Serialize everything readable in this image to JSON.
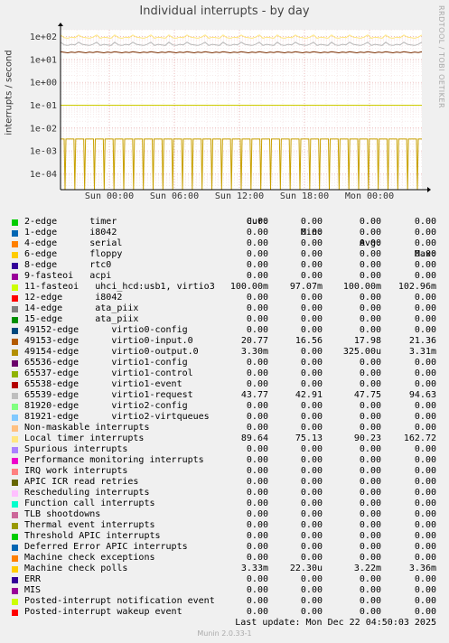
{
  "title": "Individual interrupts - by day",
  "ylabel": "interrupts / second",
  "watermark": "RRDTOOL / TOBI OETIKER",
  "footer": {
    "last_update": "Last update:  Mon Dec 22 04:50:03 2025",
    "version": "Munin 2.0.33-1"
  },
  "chart_data": {
    "type": "line",
    "title": "Individual interrupts - by day",
    "ylabel": "interrupts / second",
    "yscale": "log",
    "ylim": [
      2e-05,
      200
    ],
    "ytick_labels": [
      "1e+02",
      "1e+01",
      "1e+00",
      "1e-01",
      "1e-02",
      "1e-03",
      "1e-04"
    ],
    "yticks": [
      100,
      10,
      1,
      0.1,
      0.01,
      0.001,
      0.0001
    ],
    "xtick_labels": [
      "Sun 00:00",
      "Sun 06:00",
      "Sun 12:00",
      "Sun 18:00",
      "Mon 00:00"
    ],
    "grid": true,
    "series": [
      {
        "name": "Local timer interrupts",
        "color": "#FFE680",
        "level": 89.64
      },
      {
        "name": "virtio1-request",
        "color": "#B8B8B8",
        "level": 43.77
      },
      {
        "name": "virtio0-input.0",
        "color": "#7A2E00",
        "level": 20.77
      },
      {
        "name": "uhci_hcd:usb1, virtio3",
        "color": "#CCCC00",
        "level": 0.1
      },
      {
        "name": "Machine check polls",
        "color": "#C8A000",
        "level": 0.00333
      }
    ]
  },
  "legend": {
    "headers": {
      "cur": "Cur:",
      "min": "Min:",
      "avg": "Avg:",
      "max": "Max:"
    },
    "rows": [
      {
        "name": "2-edge      timer",
        "color": "#00CC00",
        "cur": "0.00",
        "min": "0.00",
        "avg": "0.00",
        "max": "0.00"
      },
      {
        "name": "1-edge      i8042",
        "color": "#0066B3",
        "cur": "0.00",
        "min": "0.00",
        "avg": "0.00",
        "max": "0.00"
      },
      {
        "name": "4-edge      serial",
        "color": "#FF8000",
        "cur": "0.00",
        "min": "0.00",
        "avg": "0.00",
        "max": "0.00"
      },
      {
        "name": "6-edge      floppy",
        "color": "#FFCC00",
        "cur": "0.00",
        "min": "0.00",
        "avg": "0.00",
        "max": "0.00"
      },
      {
        "name": "8-edge      rtc0",
        "color": "#330099",
        "cur": "0.00",
        "min": "0.00",
        "avg": "0.00",
        "max": "0.00"
      },
      {
        "name": "9-fasteoi   acpi",
        "color": "#990099",
        "cur": "0.00",
        "min": "0.00",
        "avg": "0.00",
        "max": "0.00"
      },
      {
        "name": "11-fasteoi   uhci_hcd:usb1, virtio3",
        "color": "#CCFF00",
        "cur": "100.00m",
        "min": "97.07m",
        "avg": "100.00m",
        "max": "102.96m"
      },
      {
        "name": "12-edge      i8042",
        "color": "#FF0000",
        "cur": "0.00",
        "min": "0.00",
        "avg": "0.00",
        "max": "0.00"
      },
      {
        "name": "14-edge      ata_piix",
        "color": "#808080",
        "cur": "0.00",
        "min": "0.00",
        "avg": "0.00",
        "max": "0.00"
      },
      {
        "name": "15-edge      ata_piix",
        "color": "#008F00",
        "cur": "0.00",
        "min": "0.00",
        "avg": "0.00",
        "max": "0.00"
      },
      {
        "name": "49152-edge      virtio0-config",
        "color": "#00487D",
        "cur": "0.00",
        "min": "0.00",
        "avg": "0.00",
        "max": "0.00"
      },
      {
        "name": "49153-edge      virtio0-input.0",
        "color": "#B35A00",
        "cur": "20.77",
        "min": "16.56",
        "avg": "17.98",
        "max": "21.36"
      },
      {
        "name": "49154-edge      virtio0-output.0",
        "color": "#B38F00",
        "cur": "3.30m",
        "min": "0.00",
        "avg": "325.00u",
        "max": "3.31m"
      },
      {
        "name": "65536-edge      virtio1-config",
        "color": "#6B006B",
        "cur": "0.00",
        "min": "0.00",
        "avg": "0.00",
        "max": "0.00"
      },
      {
        "name": "65537-edge      virtio1-control",
        "color": "#8FB300",
        "cur": "0.00",
        "min": "0.00",
        "avg": "0.00",
        "max": "0.00"
      },
      {
        "name": "65538-edge      virtio1-event",
        "color": "#B30000",
        "cur": "0.00",
        "min": "0.00",
        "avg": "0.00",
        "max": "0.00"
      },
      {
        "name": "65539-edge      virtio1-request",
        "color": "#BEBEBE",
        "cur": "43.77",
        "min": "42.91",
        "avg": "47.75",
        "max": "94.63"
      },
      {
        "name": "81920-edge      virtio2-config",
        "color": "#80FF80",
        "cur": "0.00",
        "min": "0.00",
        "avg": "0.00",
        "max": "0.00"
      },
      {
        "name": "81921-edge      virtio2-virtqueues",
        "color": "#80C9FF",
        "cur": "0.00",
        "min": "0.00",
        "avg": "0.00",
        "max": "0.00"
      },
      {
        "name": "Non-maskable interrupts",
        "color": "#FFC080",
        "cur": "0.00",
        "min": "0.00",
        "avg": "0.00",
        "max": "0.00"
      },
      {
        "name": "Local timer interrupts",
        "color": "#FFE680",
        "cur": "89.64",
        "min": "75.13",
        "avg": "90.23",
        "max": "162.72"
      },
      {
        "name": "Spurious interrupts",
        "color": "#AA80FF",
        "cur": "0.00",
        "min": "0.00",
        "avg": "0.00",
        "max": "0.00"
      },
      {
        "name": "Performance monitoring interrupts",
        "color": "#EE00CC",
        "cur": "0.00",
        "min": "0.00",
        "avg": "0.00",
        "max": "0.00"
      },
      {
        "name": "IRQ work interrupts",
        "color": "#FF8080",
        "cur": "0.00",
        "min": "0.00",
        "avg": "0.00",
        "max": "0.00"
      },
      {
        "name": "APIC ICR read retries",
        "color": "#666600",
        "cur": "0.00",
        "min": "0.00",
        "avg": "0.00",
        "max": "0.00"
      },
      {
        "name": "Rescheduling interrupts",
        "color": "#FFBFFF",
        "cur": "0.00",
        "min": "0.00",
        "avg": "0.00",
        "max": "0.00"
      },
      {
        "name": "Function call interrupts",
        "color": "#00FFCC",
        "cur": "0.00",
        "min": "0.00",
        "avg": "0.00",
        "max": "0.00"
      },
      {
        "name": "TLB shootdowns",
        "color": "#CC6699",
        "cur": "0.00",
        "min": "0.00",
        "avg": "0.00",
        "max": "0.00"
      },
      {
        "name": "Thermal event interrupts",
        "color": "#999900",
        "cur": "0.00",
        "min": "0.00",
        "avg": "0.00",
        "max": "0.00"
      },
      {
        "name": "Threshold APIC interrupts",
        "color": "#00CC00",
        "cur": "0.00",
        "min": "0.00",
        "avg": "0.00",
        "max": "0.00"
      },
      {
        "name": "Deferred Error APIC interrupts",
        "color": "#0066B3",
        "cur": "0.00",
        "min": "0.00",
        "avg": "0.00",
        "max": "0.00"
      },
      {
        "name": "Machine check exceptions",
        "color": "#FF8000",
        "cur": "0.00",
        "min": "0.00",
        "avg": "0.00",
        "max": "0.00"
      },
      {
        "name": "Machine check polls",
        "color": "#FFCC00",
        "cur": "3.33m",
        "min": "22.30u",
        "avg": "3.22m",
        "max": "3.36m"
      },
      {
        "name": "ERR",
        "color": "#330099",
        "cur": "0.00",
        "min": "0.00",
        "avg": "0.00",
        "max": "0.00"
      },
      {
        "name": "MIS",
        "color": "#990099",
        "cur": "0.00",
        "min": "0.00",
        "avg": "0.00",
        "max": "0.00"
      },
      {
        "name": "Posted-interrupt notification event",
        "color": "#CCFF00",
        "cur": "0.00",
        "min": "0.00",
        "avg": "0.00",
        "max": "0.00"
      },
      {
        "name": "Posted-interrupt wakeup event",
        "color": "#FF0000",
        "cur": "0.00",
        "min": "0.00",
        "avg": "0.00",
        "max": "0.00"
      }
    ]
  }
}
